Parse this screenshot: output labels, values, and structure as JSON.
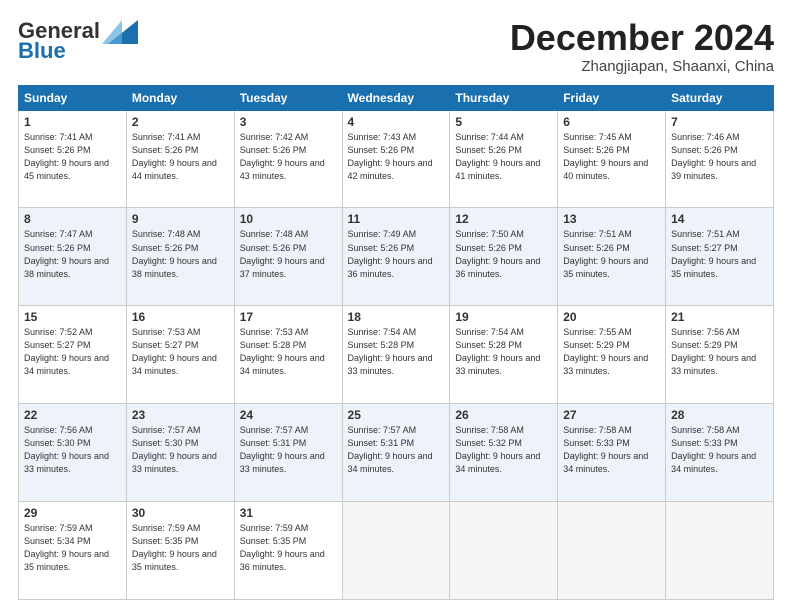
{
  "logo": {
    "line1": "General",
    "line2": "Blue"
  },
  "title": "December 2024",
  "location": "Zhangjiapan, Shaanxi, China",
  "days_of_week": [
    "Sunday",
    "Monday",
    "Tuesday",
    "Wednesday",
    "Thursday",
    "Friday",
    "Saturday"
  ],
  "weeks": [
    [
      {
        "num": "1",
        "sunrise": "7:41 AM",
        "sunset": "5:26 PM",
        "daylight": "9 hours and 45 minutes."
      },
      {
        "num": "2",
        "sunrise": "7:41 AM",
        "sunset": "5:26 PM",
        "daylight": "9 hours and 44 minutes."
      },
      {
        "num": "3",
        "sunrise": "7:42 AM",
        "sunset": "5:26 PM",
        "daylight": "9 hours and 43 minutes."
      },
      {
        "num": "4",
        "sunrise": "7:43 AM",
        "sunset": "5:26 PM",
        "daylight": "9 hours and 42 minutes."
      },
      {
        "num": "5",
        "sunrise": "7:44 AM",
        "sunset": "5:26 PM",
        "daylight": "9 hours and 41 minutes."
      },
      {
        "num": "6",
        "sunrise": "7:45 AM",
        "sunset": "5:26 PM",
        "daylight": "9 hours and 40 minutes."
      },
      {
        "num": "7",
        "sunrise": "7:46 AM",
        "sunset": "5:26 PM",
        "daylight": "9 hours and 39 minutes."
      }
    ],
    [
      {
        "num": "8",
        "sunrise": "7:47 AM",
        "sunset": "5:26 PM",
        "daylight": "9 hours and 38 minutes."
      },
      {
        "num": "9",
        "sunrise": "7:48 AM",
        "sunset": "5:26 PM",
        "daylight": "9 hours and 38 minutes."
      },
      {
        "num": "10",
        "sunrise": "7:48 AM",
        "sunset": "5:26 PM",
        "daylight": "9 hours and 37 minutes."
      },
      {
        "num": "11",
        "sunrise": "7:49 AM",
        "sunset": "5:26 PM",
        "daylight": "9 hours and 36 minutes."
      },
      {
        "num": "12",
        "sunrise": "7:50 AM",
        "sunset": "5:26 PM",
        "daylight": "9 hours and 36 minutes."
      },
      {
        "num": "13",
        "sunrise": "7:51 AM",
        "sunset": "5:26 PM",
        "daylight": "9 hours and 35 minutes."
      },
      {
        "num": "14",
        "sunrise": "7:51 AM",
        "sunset": "5:27 PM",
        "daylight": "9 hours and 35 minutes."
      }
    ],
    [
      {
        "num": "15",
        "sunrise": "7:52 AM",
        "sunset": "5:27 PM",
        "daylight": "9 hours and 34 minutes."
      },
      {
        "num": "16",
        "sunrise": "7:53 AM",
        "sunset": "5:27 PM",
        "daylight": "9 hours and 34 minutes."
      },
      {
        "num": "17",
        "sunrise": "7:53 AM",
        "sunset": "5:28 PM",
        "daylight": "9 hours and 34 minutes."
      },
      {
        "num": "18",
        "sunrise": "7:54 AM",
        "sunset": "5:28 PM",
        "daylight": "9 hours and 33 minutes."
      },
      {
        "num": "19",
        "sunrise": "7:54 AM",
        "sunset": "5:28 PM",
        "daylight": "9 hours and 33 minutes."
      },
      {
        "num": "20",
        "sunrise": "7:55 AM",
        "sunset": "5:29 PM",
        "daylight": "9 hours and 33 minutes."
      },
      {
        "num": "21",
        "sunrise": "7:56 AM",
        "sunset": "5:29 PM",
        "daylight": "9 hours and 33 minutes."
      }
    ],
    [
      {
        "num": "22",
        "sunrise": "7:56 AM",
        "sunset": "5:30 PM",
        "daylight": "9 hours and 33 minutes."
      },
      {
        "num": "23",
        "sunrise": "7:57 AM",
        "sunset": "5:30 PM",
        "daylight": "9 hours and 33 minutes."
      },
      {
        "num": "24",
        "sunrise": "7:57 AM",
        "sunset": "5:31 PM",
        "daylight": "9 hours and 33 minutes."
      },
      {
        "num": "25",
        "sunrise": "7:57 AM",
        "sunset": "5:31 PM",
        "daylight": "9 hours and 34 minutes."
      },
      {
        "num": "26",
        "sunrise": "7:58 AM",
        "sunset": "5:32 PM",
        "daylight": "9 hours and 34 minutes."
      },
      {
        "num": "27",
        "sunrise": "7:58 AM",
        "sunset": "5:33 PM",
        "daylight": "9 hours and 34 minutes."
      },
      {
        "num": "28",
        "sunrise": "7:58 AM",
        "sunset": "5:33 PM",
        "daylight": "9 hours and 34 minutes."
      }
    ],
    [
      {
        "num": "29",
        "sunrise": "7:59 AM",
        "sunset": "5:34 PM",
        "daylight": "9 hours and 35 minutes."
      },
      {
        "num": "30",
        "sunrise": "7:59 AM",
        "sunset": "5:35 PM",
        "daylight": "9 hours and 35 minutes."
      },
      {
        "num": "31",
        "sunrise": "7:59 AM",
        "sunset": "5:35 PM",
        "daylight": "9 hours and 36 minutes."
      },
      null,
      null,
      null,
      null
    ]
  ]
}
